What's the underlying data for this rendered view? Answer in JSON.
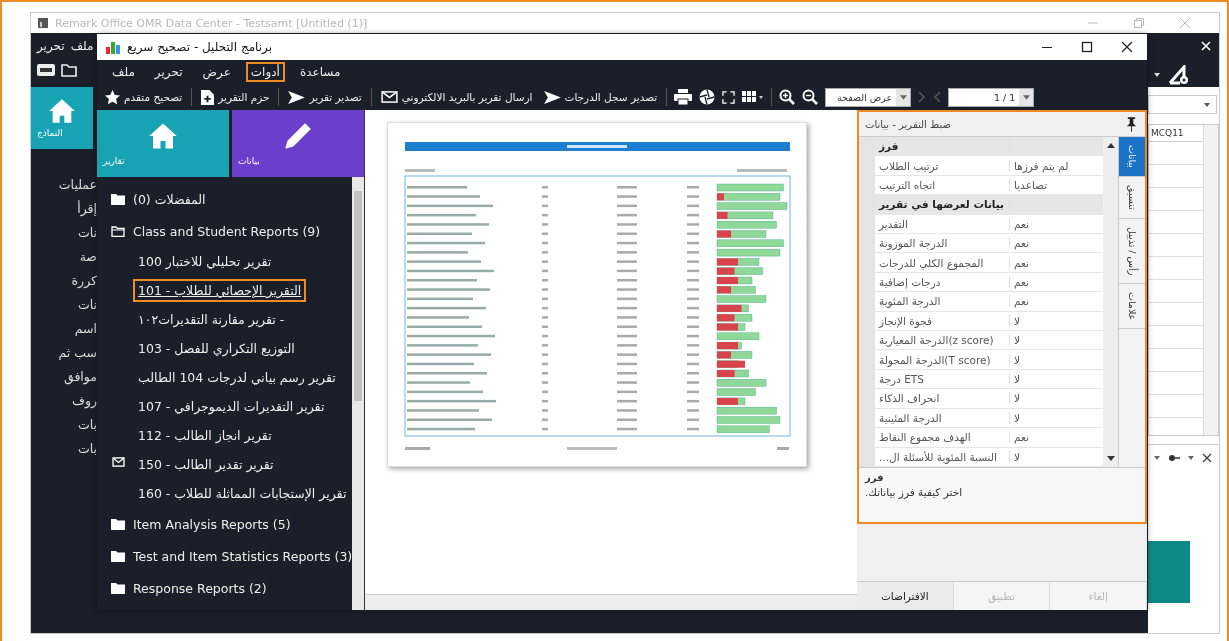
{
  "back_window": {
    "title": "Remark Office OMR Data Center - Testsamt [Untitled (1)]",
    "menu": [
      "ملف",
      "تحرير"
    ],
    "tile": {
      "label": "النماذج"
    },
    "sidebar_items": [
      "عمليات",
      "إقرأ",
      "نات",
      "صة",
      "كررة",
      "نات",
      "اسم",
      "سب ثم",
      "موافق",
      "روف",
      "بات",
      "بات"
    ],
    "grid_header": "MCQ11"
  },
  "window": {
    "title": "برنامج التحليل - تصحيح سريع"
  },
  "menu": [
    {
      "label": "مساعدة",
      "highlighted": false
    },
    {
      "label": "أدوات",
      "highlighted": true
    },
    {
      "label": "عرض",
      "highlighted": false
    },
    {
      "label": "تحرير",
      "highlighted": false
    },
    {
      "label": "ملف",
      "highlighted": false
    }
  ],
  "toolbar": [
    {
      "kind": "dropdown",
      "value": "1 / 1"
    },
    {
      "kind": "nav",
      "disabled": true
    },
    {
      "kind": "nav",
      "disabled": true
    },
    {
      "kind": "dropdown",
      "value": "عرض الصفحة"
    },
    {
      "kind": "icon"
    },
    {
      "kind": "icon"
    },
    {
      "kind": "separator"
    },
    {
      "kind": "icon"
    },
    {
      "kind": "icon"
    },
    {
      "kind": "icon"
    },
    {
      "kind": "icon"
    },
    {
      "kind": "separator"
    },
    {
      "kind": "button",
      "label": "تصدير سجل الدرجات"
    },
    {
      "kind": "button",
      "label": "ارسال تقرير بالبريد الالكتروني"
    },
    {
      "kind": "separator"
    },
    {
      "kind": "button",
      "label": "تصدير تقرير"
    },
    {
      "kind": "separator"
    },
    {
      "kind": "button",
      "label": "حزم التقرير"
    },
    {
      "kind": "separator"
    },
    {
      "kind": "button",
      "label": "تصحيح متقدم"
    }
  ],
  "tiles": [
    {
      "label": "بيانات",
      "color": "#6a3fcb"
    },
    {
      "label": "تقارير",
      "color": "#17a3b3"
    }
  ],
  "tree": [
    {
      "label": "المفضلات (0)",
      "expanded": false
    },
    {
      "label": "Class and Student Reports (9)",
      "expanded": true,
      "children": [
        {
          "label": "تقرير تحليلي للاختبار 100",
          "selected": false,
          "emailed": false
        },
        {
          "label": "التقرير الإحصائي للطلاب - 101",
          "selected": true,
          "emailed": false
        },
        {
          "label": "- تقرير مقارنة التقديرات١٠٢",
          "selected": false,
          "emailed": false
        },
        {
          "label": "التوزيع التكراري للفصل - 103",
          "selected": false,
          "emailed": false
        },
        {
          "label": "تقرير رسم بياني لدرجات 104 الطالب",
          "selected": false,
          "emailed": false
        },
        {
          "label": "تقرير التقديرات الديموجرافي - 107",
          "selected": false,
          "emailed": false
        },
        {
          "label": "تقرير انجاز الطالب - 112",
          "selected": false,
          "emailed": false
        },
        {
          "label": "تقرير تقدير الطالب - 150",
          "selected": false,
          "emailed": true
        },
        {
          "label": "تقرير الإستجابات المماثلة للطلاب - 160",
          "selected": false,
          "emailed": false
        }
      ]
    },
    {
      "label": "Item Analysis Reports (5)",
      "expanded": false
    },
    {
      "label": "Test and Item Statistics Reports (3)",
      "expanded": false
    },
    {
      "label": "Response Reports (2)",
      "expanded": false
    }
  ],
  "properties": {
    "title": "ضبط التقرير - بيانات",
    "highlighted": true,
    "tabs": [
      {
        "label": "بيانات",
        "selected": true
      },
      {
        "label": "تنسيق",
        "selected": false
      },
      {
        "label": "رأس / تذييل",
        "selected": false
      },
      {
        "label": "علامات",
        "selected": false
      }
    ],
    "rows": [
      {
        "kind": "category",
        "label": "فرز"
      },
      {
        "kind": "property",
        "label": "ترتيب الطلاب",
        "value": "لم يتم فرزها"
      },
      {
        "kind": "property",
        "label": "اتجاه الترتيب",
        "value": "تصاعديا"
      },
      {
        "kind": "category",
        "label": "بيانات لعرضها في تقرير"
      },
      {
        "kind": "property",
        "label": "التقدير",
        "value": "نعم"
      },
      {
        "kind": "property",
        "label": "الدرجة الموزونة",
        "value": "نعم"
      },
      {
        "kind": "property",
        "label": "المجموع الكلي للدرجات",
        "value": "نعم"
      },
      {
        "kind": "property",
        "label": "درجات إضافية",
        "value": "نعم"
      },
      {
        "kind": "property",
        "label": "الدرجة المئوية",
        "value": "نعم"
      },
      {
        "kind": "property",
        "label": "فجوة الإنجاز",
        "value": "لا"
      },
      {
        "kind": "property",
        "label": "(z score)الدرجة المعيارية",
        "value": "لا"
      },
      {
        "kind": "property",
        "label": "(T score)الدرجة المحولة",
        "value": "لا"
      },
      {
        "kind": "property",
        "label": "ETS درجة",
        "value": "لا"
      },
      {
        "kind": "property",
        "label": "انحراف الذكاء",
        "value": "لا"
      },
      {
        "kind": "property",
        "label": "الدرجة المئينية",
        "value": "لا"
      },
      {
        "kind": "property",
        "label": "الهدف مجموع النقاط",
        "value": "نعم"
      },
      {
        "kind": "property",
        "label": "النسبة المئوية للأسئلة ال...",
        "value": "لا"
      }
    ],
    "help": {
      "title": "فرز",
      "text": "اختر كيفية فرز بياناتك."
    },
    "buttons": [
      {
        "label": "إلغاء",
        "disabled": true
      },
      {
        "label": "تطبيق",
        "disabled": true
      },
      {
        "label": "الافتراضات",
        "disabled": false
      }
    ]
  }
}
